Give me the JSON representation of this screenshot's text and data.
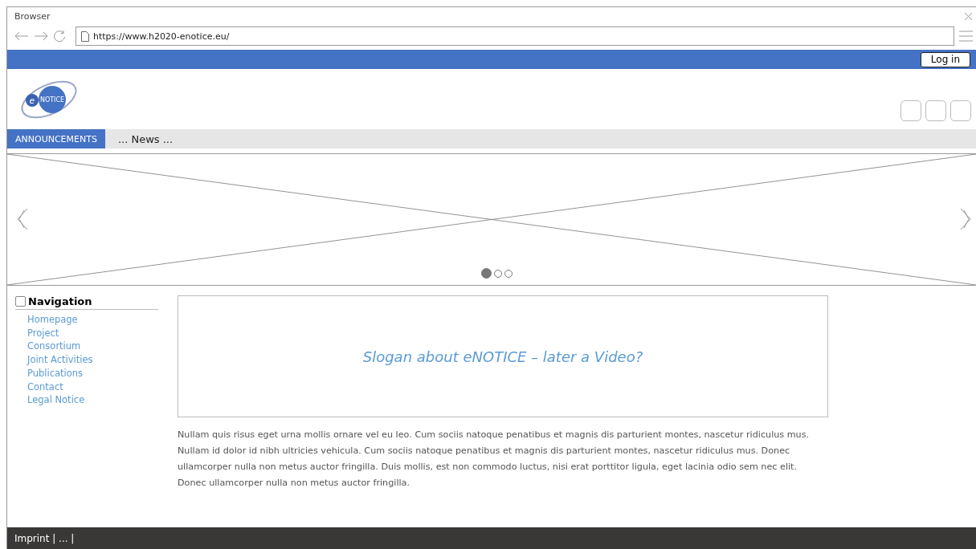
{
  "window": {
    "title": "Browser",
    "url": "https://www.h2020-enotice.eu/"
  },
  "top_bar": {
    "login_label": "Log in"
  },
  "logo": {
    "letter": "e",
    "word": "NOTICE"
  },
  "menu": [
    {
      "label": "ANNOUNCEMENTS",
      "selected": true
    },
    {
      "label": "... News ...",
      "selected": false
    }
  ],
  "carousel": {
    "slides": [
      {
        "selected": true
      },
      {
        "selected": false
      },
      {
        "selected": false
      }
    ]
  },
  "navigation": {
    "title": "Navigation",
    "checked": false,
    "items": [
      "Homepage",
      "Project",
      "Consortium",
      "Joint Activities",
      "Publications",
      "Contact",
      "Legal Notice"
    ]
  },
  "slogan": "Slogan about eNOTICE – later a Video?",
  "body_text": "Nullam quis risus eget urna mollis ornare vel eu leo. Cum sociis natoque penatibus et magnis dis parturient montes, nascetur ridiculus mus. Nullam id dolor id nibh ultricies vehicula. Cum sociis natoque penatibus et magnis dis parturient montes, nascetur ridiculus mus. Donec ullamcorper nulla non metus auctor fringilla. Duis mollis, est non commodo luctus, nisi erat porttitor ligula, eget lacinia odio sem nec elit. Donec ullamcorper nulla non metus auctor fringilla.",
  "footer": "Imprint | ... |"
}
